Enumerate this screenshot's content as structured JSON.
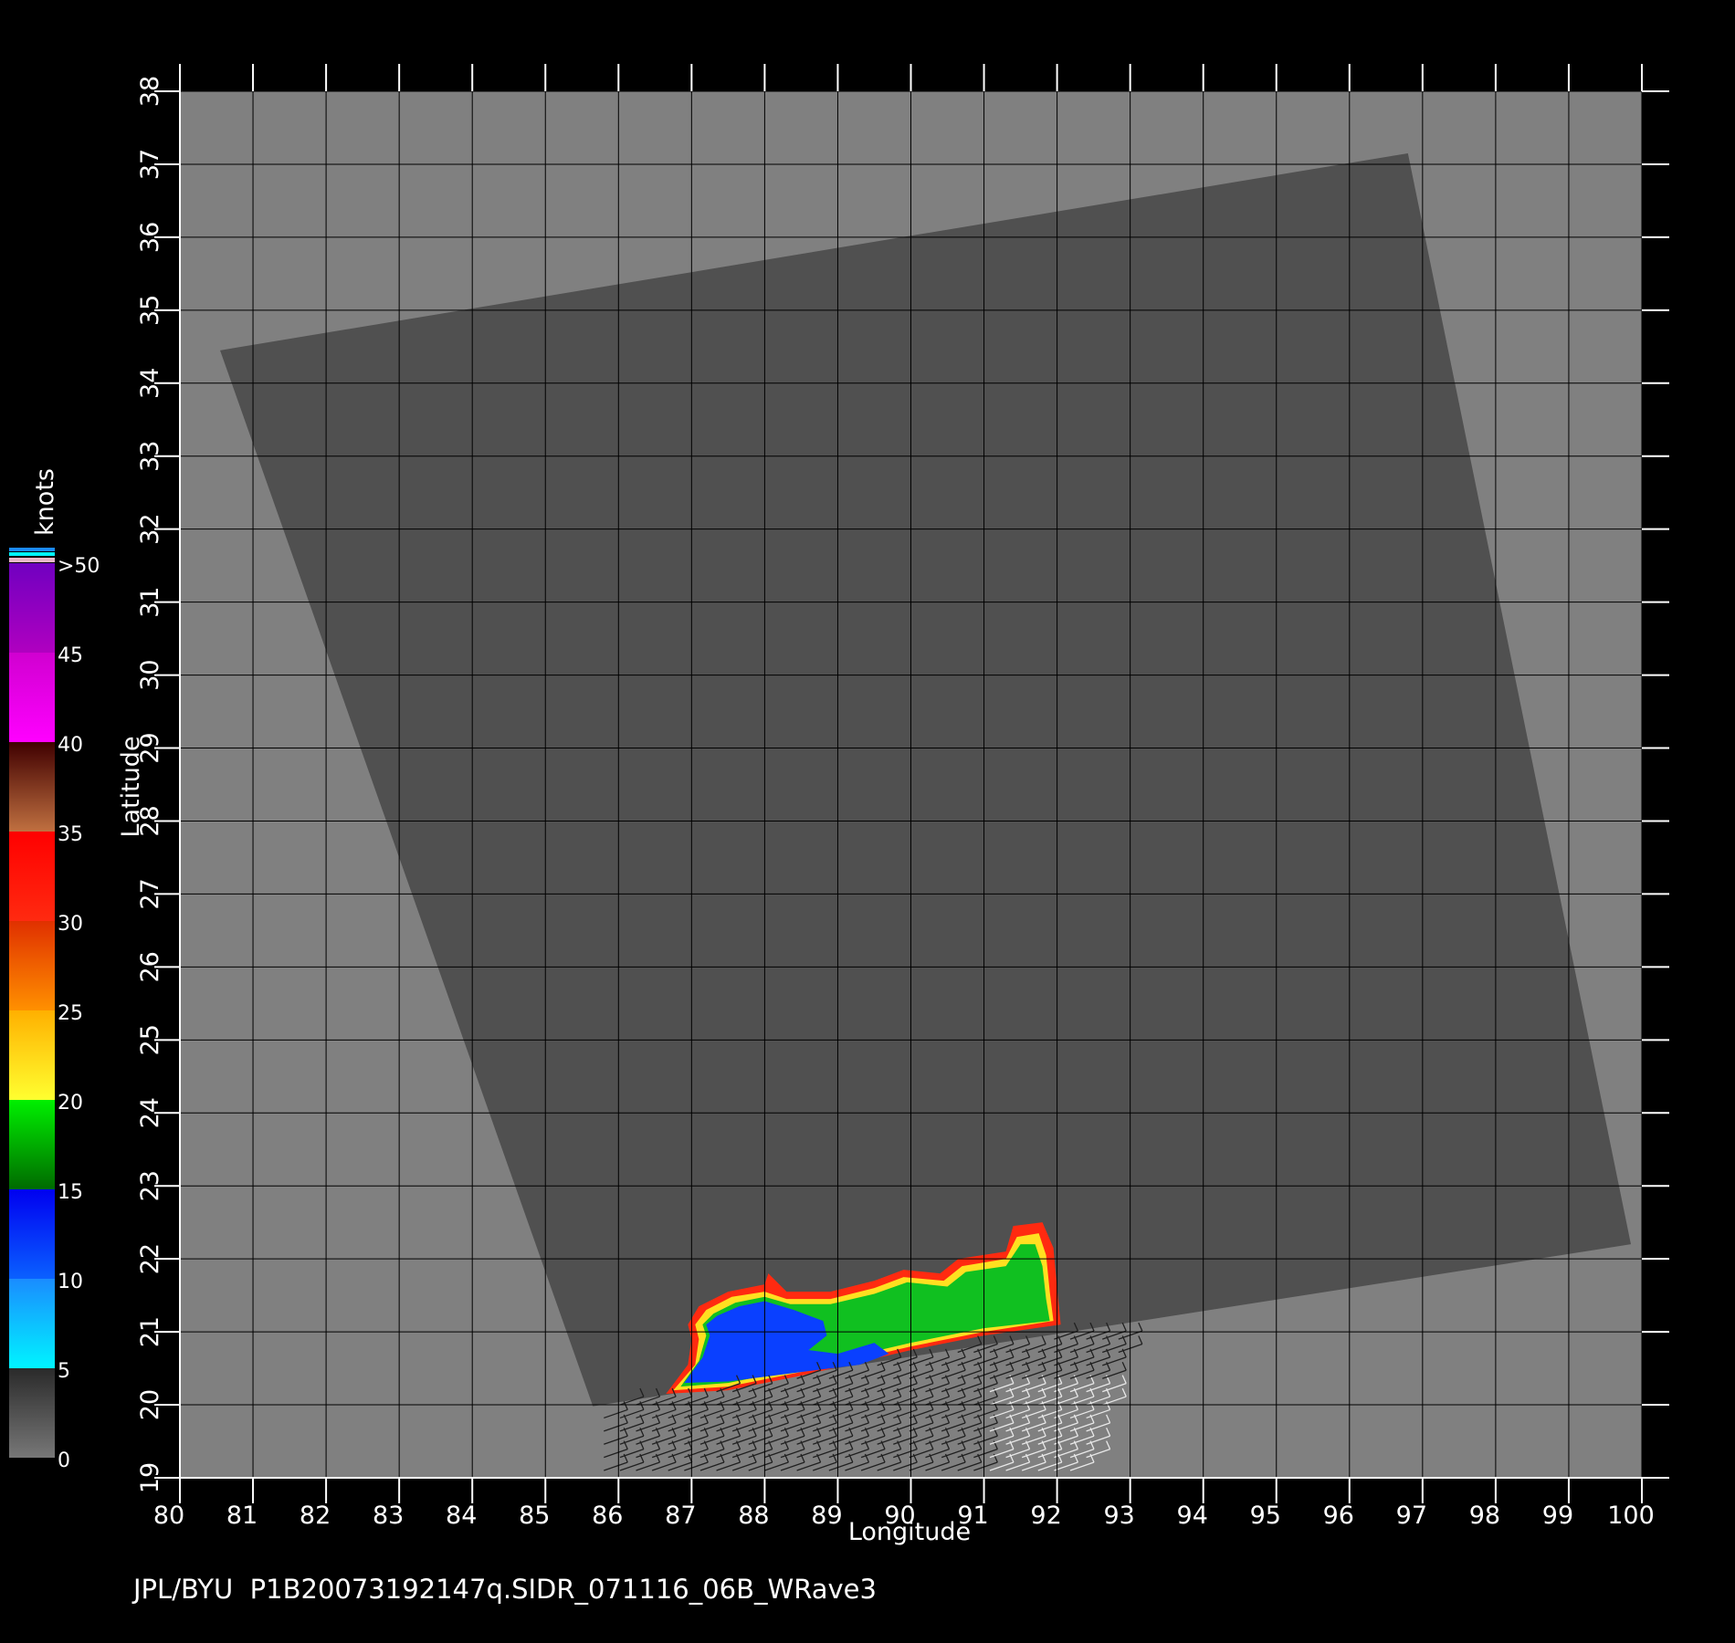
{
  "footer": {
    "source": "JPL/BYU",
    "filename": "P1B20073192147q.SIDR_071116_06B_WRave3"
  },
  "axes": {
    "x_label": "Longitude",
    "y_label": "Latitude",
    "x_ticks": [
      "80",
      "81",
      "82",
      "83",
      "84",
      "85",
      "86",
      "87",
      "88",
      "89",
      "90",
      "91",
      "92",
      "93",
      "94",
      "95",
      "96",
      "97",
      "98",
      "99",
      "100"
    ],
    "y_ticks": [
      "19",
      "20",
      "21",
      "22",
      "23",
      "24",
      "25",
      "26",
      "27",
      "28",
      "29",
      "30",
      "31",
      "32",
      "33",
      "34",
      "35",
      "36",
      "37",
      "38"
    ],
    "lon_range": [
      80,
      100
    ],
    "lat_range": [
      19,
      38
    ]
  },
  "colorbar": {
    "unit": "knots",
    "labels": [
      "0",
      "5",
      "10",
      "15",
      "20",
      "25",
      "30",
      "35",
      "40",
      "45",
      ">50"
    ],
    "bands": [
      {
        "from": 0,
        "to": 5,
        "colors": [
          "#777777",
          "#2a2a2a"
        ]
      },
      {
        "from": 5,
        "to": 10,
        "colors": [
          "#00f4ff",
          "#1a8cff"
        ]
      },
      {
        "from": 10,
        "to": 15,
        "colors": [
          "#0a60ff",
          "#0000f0"
        ]
      },
      {
        "from": 15,
        "to": 20,
        "colors": [
          "#006a00",
          "#00f000"
        ]
      },
      {
        "from": 20,
        "to": 25,
        "colors": [
          "#ffff30",
          "#ffb000"
        ]
      },
      {
        "from": 25,
        "to": 30,
        "colors": [
          "#ff9000",
          "#e03000"
        ]
      },
      {
        "from": 30,
        "to": 35,
        "colors": [
          "#ff2a10",
          "#ff0000"
        ]
      },
      {
        "from": 35,
        "to": 40,
        "colors": [
          "#c07040",
          "#400000"
        ]
      },
      {
        "from": 40,
        "to": 45,
        "colors": [
          "#ff00ff",
          "#d000d0"
        ]
      },
      {
        "from": 45,
        "to": 50,
        "colors": [
          "#b000c0",
          "#7000c0"
        ]
      }
    ]
  },
  "colors": {
    "background": "#000000",
    "land": "#808080",
    "swath": "#505050",
    "grid": "#000000"
  },
  "swath_corners_lonlat": [
    [
      80.55,
      34.45
    ],
    [
      96.8,
      37.15
    ],
    [
      99.85,
      22.2
    ],
    [
      85.65,
      19.98
    ]
  ],
  "wind_field": {
    "description_regions": [
      {
        "level": "blue",
        "value_knots": 12
      },
      {
        "level": "green",
        "value_knots": 17
      },
      {
        "level": "yellow",
        "value_knots": 22
      },
      {
        "level": "red",
        "value_knots": 32
      }
    ]
  }
}
